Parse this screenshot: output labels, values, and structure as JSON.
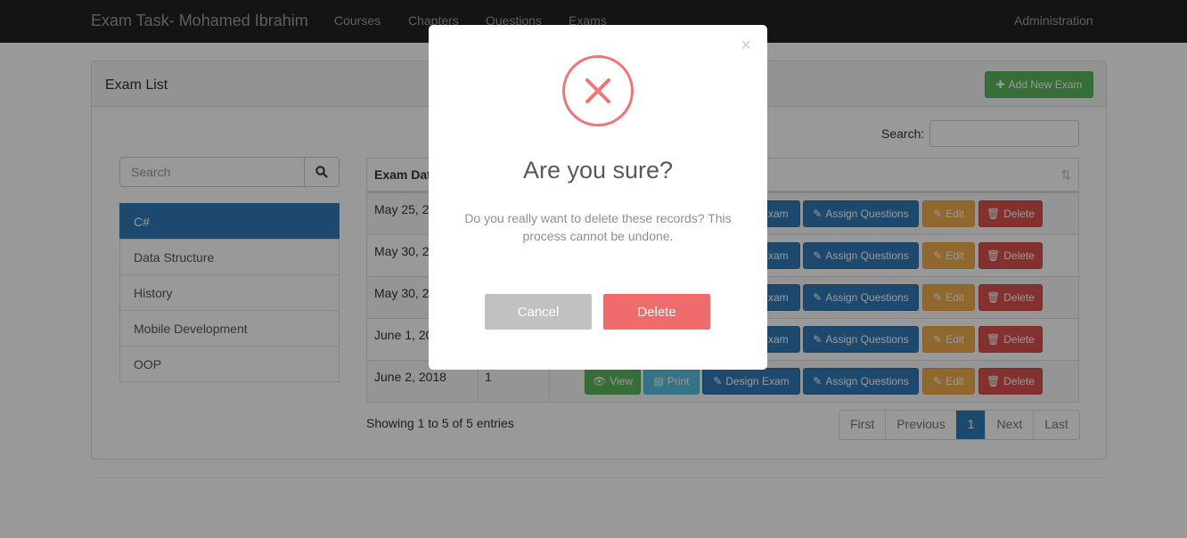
{
  "navbar": {
    "brand": "Exam Task- Mohamed Ibrahim",
    "links": [
      "Courses",
      "Chapters",
      "Questions",
      "Exams"
    ],
    "right_link": "Administration"
  },
  "panel": {
    "title": "Exam List",
    "add_button": "Add New Exam",
    "search_label": "Search:",
    "sidebar_search_placeholder": "Search",
    "categories": [
      "C#",
      "Data Structure",
      "History",
      "Mobile Development",
      "OOP"
    ],
    "active_category": "C#"
  },
  "table": {
    "header_first": "Exam Dat",
    "rows": [
      {
        "date": "May 25, 2",
        "questions": ""
      },
      {
        "date": "May 30, 2",
        "questions": ""
      },
      {
        "date": "May 30, 2",
        "questions": ""
      },
      {
        "date": "June 1, 20",
        "questions": ""
      },
      {
        "date": "June 2, 2018",
        "questions": "1"
      }
    ],
    "action_labels": {
      "view": "View",
      "print": "Print",
      "design": "Design Exam",
      "design_partial": "Exam",
      "assign": "Assign Questions",
      "edit": "Edit",
      "delete": "Delete"
    },
    "info": "Showing 1 to 5 of 5 entries",
    "pagination": [
      "First",
      "Previous",
      "1",
      "Next",
      "Last"
    ]
  },
  "modal": {
    "close": "×",
    "title": "Are you sure?",
    "text": "Do you really want to delete these records? This process cannot be undone.",
    "cancel": "Cancel",
    "delete": "Delete"
  },
  "colors": {
    "navbar": "#222222",
    "primary": "#337ab7",
    "success": "#5cb85c",
    "warning": "#f0ad4e",
    "danger": "#d9534f",
    "modal_danger": "#f06c6c"
  }
}
